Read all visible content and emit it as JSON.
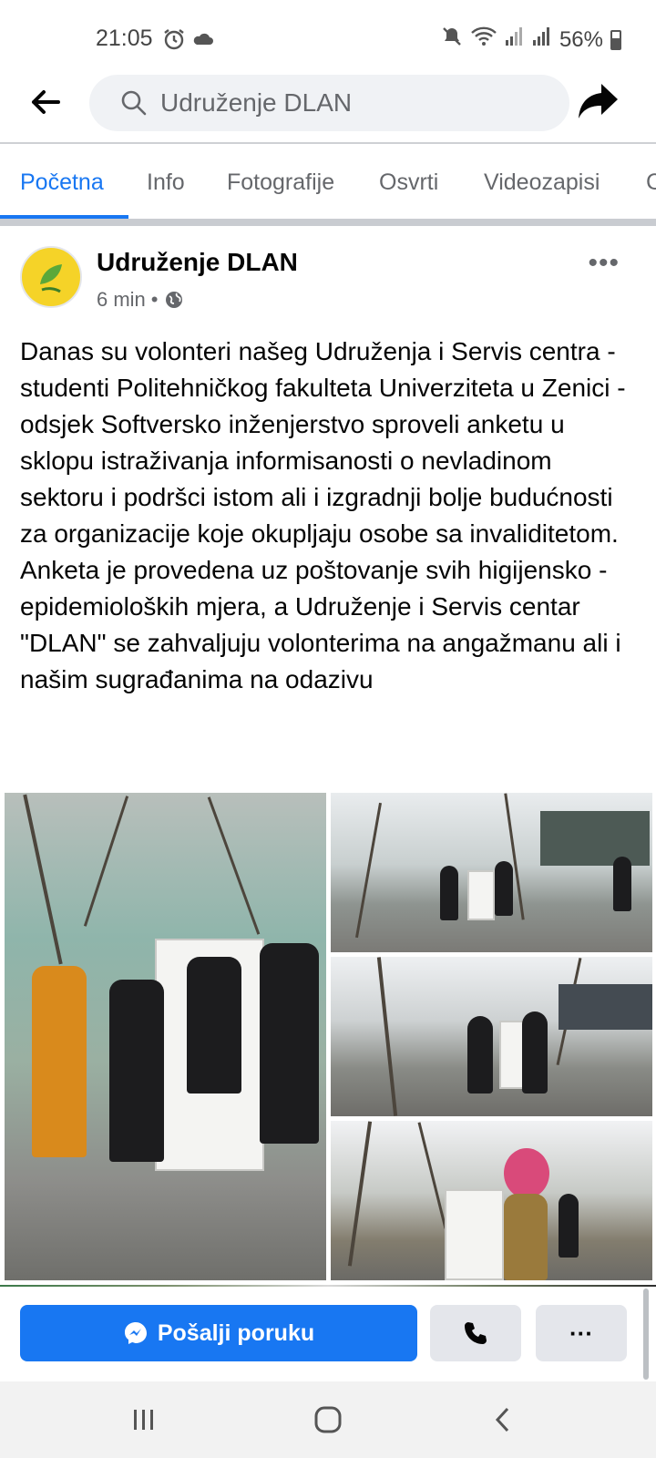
{
  "status_bar": {
    "time": "21:05",
    "battery": "56%",
    "left_icons": [
      "alarm-icon",
      "cloud-icon"
    ],
    "right_icons": [
      "mute-icon",
      "wifi-icon",
      "signal-icon",
      "signal-icon",
      "battery-icon"
    ]
  },
  "nav": {
    "search_text": "Udruženje DLAN",
    "back_icon": "back-arrow-icon",
    "share_icon": "share-icon"
  },
  "tabs": [
    {
      "label": "Početna",
      "active": true
    },
    {
      "label": "Info",
      "active": false
    },
    {
      "label": "Fotografije",
      "active": false
    },
    {
      "label": "Osvrti",
      "active": false
    },
    {
      "label": "Videozapisi",
      "active": false
    },
    {
      "label": "C",
      "active": false
    }
  ],
  "post": {
    "page_name": "Udruženje DLAN",
    "time_ago": "6 min",
    "separator": "•",
    "privacy_icon": "globe-icon",
    "body": "Danas su volonteri našeg Udruženja i Servis centra - studenti Politehničkog fakulteta Univerziteta u Zenici - odsjek Softversko inženjerstvo sproveli anketu u sklopu istraživanja informisanosti o nevladinom sektoru i podršci istom ali i izgradnji bolje budućnosti za organizacije koje okupljaju osobe sa invaliditetom. Anketa je provedena uz poštovanje svih higijensko - epidemioloških mjera, a Udruženje i Servis centar \"DLAN\" se zahvaljuju volonterima na angažmanu ali i našim sugrađanima na odazivu"
  },
  "actions": {
    "message_label": "Pošalji poruku",
    "more_label": "···"
  },
  "colors": {
    "accent": "#1877f2",
    "secondary_text": "#65676b",
    "button_gray": "#e4e6eb"
  }
}
